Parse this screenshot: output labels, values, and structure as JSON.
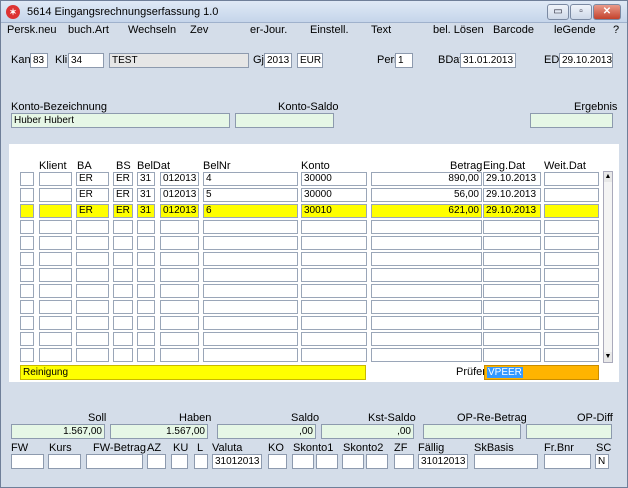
{
  "window": {
    "title": "5614 Eingangsrechnungserfassung 1.0",
    "min": "▭",
    "max": "▫",
    "close": "✕"
  },
  "menu": [
    "Persk.neu",
    "buch.Art",
    "Wechseln",
    "Zev",
    "er-Jour.",
    "Einstell.",
    "Text",
    "bel. Lösen",
    "Barcode",
    "leGende",
    "?"
  ],
  "header": {
    "kan_label": "Kan",
    "kan_value": "83",
    "kli_label": "Kli",
    "kli_value": "34",
    "name_value": "TEST",
    "gj_label": "Gj",
    "gj_value": "2013",
    "currency": "EUR",
    "peri_label": "Peri",
    "peri_value": "1",
    "bdat_label": "BDat",
    "bdat_value": "31.01.2013",
    "ed_label": "ED",
    "ed_value": "29.10.2013"
  },
  "konto": {
    "bez_label": "Konto-Bezeichnung",
    "bez_value": "Huber Hubert",
    "saldo_label": "Konto-Saldo",
    "saldo_value": "",
    "ergebnis_label": "Ergebnis",
    "ergebnis_value": ""
  },
  "table": {
    "columns": [
      "Klient",
      "BA",
      "BS",
      "BelDat",
      "BelNr",
      "Konto",
      "Betrag",
      "Eing.Dat",
      "Weit.Dat"
    ],
    "rows": [
      {
        "klient": "",
        "ba": "ER",
        "bs": "ER",
        "beldat_d": "31",
        "beldat": "012013",
        "belnr": "4",
        "konto": "30000",
        "betrag": "890,00",
        "eingdat": "29.10.2013",
        "weitdat": "",
        "selected": false
      },
      {
        "klient": "",
        "ba": "ER",
        "bs": "ER",
        "beldat_d": "31",
        "beldat": "012013",
        "belnr": "5",
        "konto": "30000",
        "betrag": "56,00",
        "eingdat": "29.10.2013",
        "weitdat": "",
        "selected": false
      },
      {
        "klient": "",
        "ba": "ER",
        "bs": "ER",
        "beldat_d": "31",
        "beldat": "012013",
        "belnr": "6",
        "konto": "30010",
        "betrag": "621,00",
        "eingdat": "29.10.2013",
        "weitdat": "",
        "selected": true
      }
    ],
    "empty_rows": 9,
    "footer_text": "Reinigung",
    "pruefer_label": "Prüfer",
    "pruefer_value": "VPEER"
  },
  "totals": {
    "soll_label": "Soll",
    "soll_value": "1.567,00",
    "haben_label": "Haben",
    "haben_value": "1.567,00",
    "saldo_label": "Saldo",
    "saldo_value": ",00",
    "kst_label": "Kst-Saldo",
    "kst_value": ",00",
    "opre_label": "OP-Re-Betrag",
    "opre_value": "",
    "opdiff_label": "OP-Diff",
    "opdiff_value": ""
  },
  "bottom": {
    "labels": [
      "FW",
      "Kurs",
      "FW-Betrag",
      "AZ",
      "KU",
      "L",
      "Valuta",
      "KO",
      "Skonto1",
      "Skonto2",
      "ZF",
      "Fällig",
      "SkBasis",
      "Fr.Bnr",
      "SC"
    ],
    "valuta_value": "31012013",
    "faellig_value": "31012013",
    "sc_value": "N"
  },
  "colors": {
    "selected_row": "#ffff00",
    "footer_yellow": "#ffff00",
    "pruefer_bg": "#ffb400",
    "pruefer_sel": "#3399ff",
    "total_field": "#e6f7e6"
  }
}
